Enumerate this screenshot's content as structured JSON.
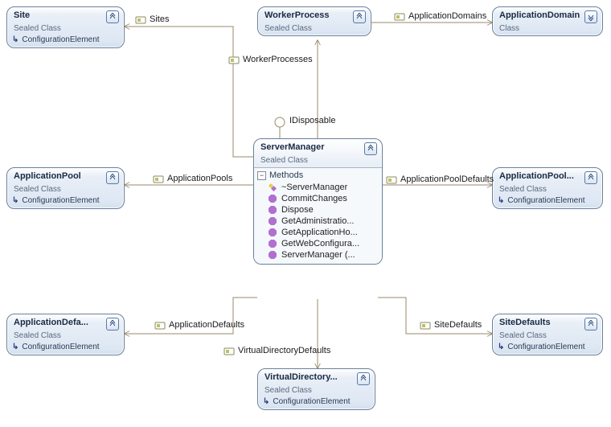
{
  "diagram_type": "UML class diagram",
  "central": {
    "name": "ServerManager",
    "stereotype": "Sealed Class",
    "interface": "IDisposable",
    "methods_label": "Methods",
    "methods": [
      "~ServerManager",
      "CommitChanges",
      "Dispose",
      "GetAdministratio...",
      "GetApplicationHo...",
      "GetWebConfigura...",
      "ServerManager (..."
    ]
  },
  "boxes": {
    "site": {
      "title": "Site",
      "sub": "Sealed Class",
      "base": "ConfigurationElement"
    },
    "workerProcess": {
      "title": "WorkerProcess",
      "sub": "Sealed Class"
    },
    "appDomain": {
      "title": "ApplicationDomain",
      "sub": "Class"
    },
    "appPool": {
      "title": "ApplicationPool",
      "sub": "Sealed Class",
      "base": "ConfigurationElement"
    },
    "appPoolDefaults": {
      "title": "ApplicationPool...",
      "sub": "Sealed Class",
      "base": "ConfigurationElement"
    },
    "appDefaults": {
      "title": "ApplicationDefa...",
      "sub": "Sealed Class",
      "base": "ConfigurationElement"
    },
    "siteDefaults": {
      "title": "SiteDefaults",
      "sub": "Sealed Class",
      "base": "ConfigurationElement"
    },
    "vdirDefaults": {
      "title": "VirtualDirectory...",
      "sub": "Sealed Class",
      "base": "ConfigurationElement"
    }
  },
  "relations": {
    "sites": "Sites",
    "workerProcesses": "WorkerProcesses",
    "applicationDomains": "ApplicationDomains",
    "applicationPools": "ApplicationPools",
    "applicationPoolDefaults": "ApplicationPoolDefaults",
    "applicationDefaults": "ApplicationDefaults",
    "siteDefaults": "SiteDefaults",
    "virtualDirectoryDefaults": "VirtualDirectoryDefaults"
  }
}
